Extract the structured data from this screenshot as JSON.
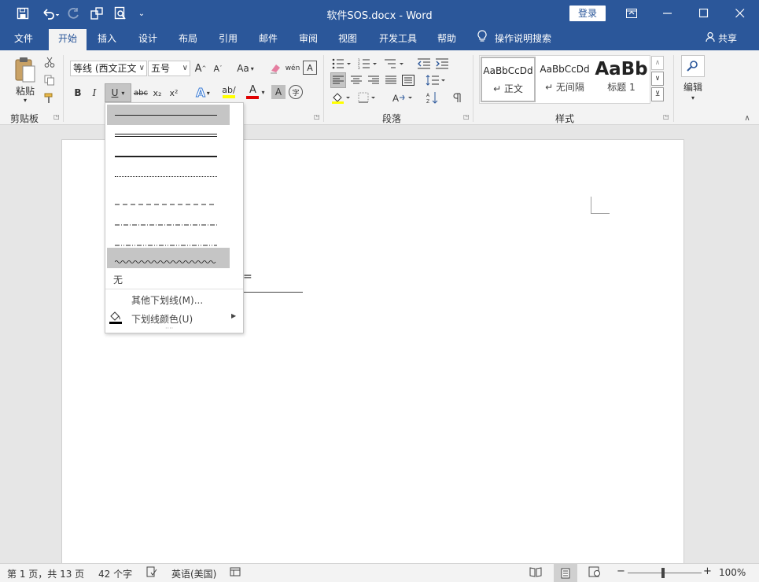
{
  "window": {
    "title": "软件SOS.docx  -  Word",
    "login_label": "登录"
  },
  "tabs": [
    {
      "label": "文件"
    },
    {
      "label": "开始"
    },
    {
      "label": "插入"
    },
    {
      "label": "设计"
    },
    {
      "label": "布局"
    },
    {
      "label": "引用"
    },
    {
      "label": "邮件"
    },
    {
      "label": "审阅"
    },
    {
      "label": "视图"
    },
    {
      "label": "开发工具"
    },
    {
      "label": "帮助"
    }
  ],
  "tell_me": "操作说明搜索",
  "share_label": "共享",
  "ribbon": {
    "clipboard": {
      "paste_label": "粘贴",
      "group_label": "剪贴板"
    },
    "font": {
      "font_name": "等线 (西文正文",
      "font_size": "五号",
      "bold": "B",
      "italic": "I",
      "underline": "U",
      "strike": "abc",
      "subscript": "x₂",
      "superscript": "x²",
      "change_case": "Aa",
      "phonetic": "wén",
      "text_effect": "A",
      "font_color": "A",
      "shading": "A",
      "enclose": "字"
    },
    "paragraph": {
      "group_label": "段落"
    },
    "styles": {
      "group_label": "样式",
      "items": [
        {
          "sample": "AaBbCcDd",
          "name": "↵ 正文"
        },
        {
          "sample": "AaBbCcDd",
          "name": "↵ 无间隔"
        },
        {
          "sample": "AaBb",
          "name": "标题 1"
        }
      ]
    },
    "editing": {
      "label": "编辑"
    }
  },
  "underline_menu": {
    "none_label": "无",
    "more_label": "其他下划线(M)...",
    "color_label": "下划线颜色(U)",
    "more_dots": "····"
  },
  "document": {
    "fragment": "="
  },
  "status": {
    "page": "第 1 页，共 13 页",
    "words": "42 个字",
    "language": "英语(美国)",
    "zoom": "100%"
  },
  "colors": {
    "accent": "#2b579a",
    "highlight_yellow": "#ffff00",
    "font_red": "#e00000"
  }
}
